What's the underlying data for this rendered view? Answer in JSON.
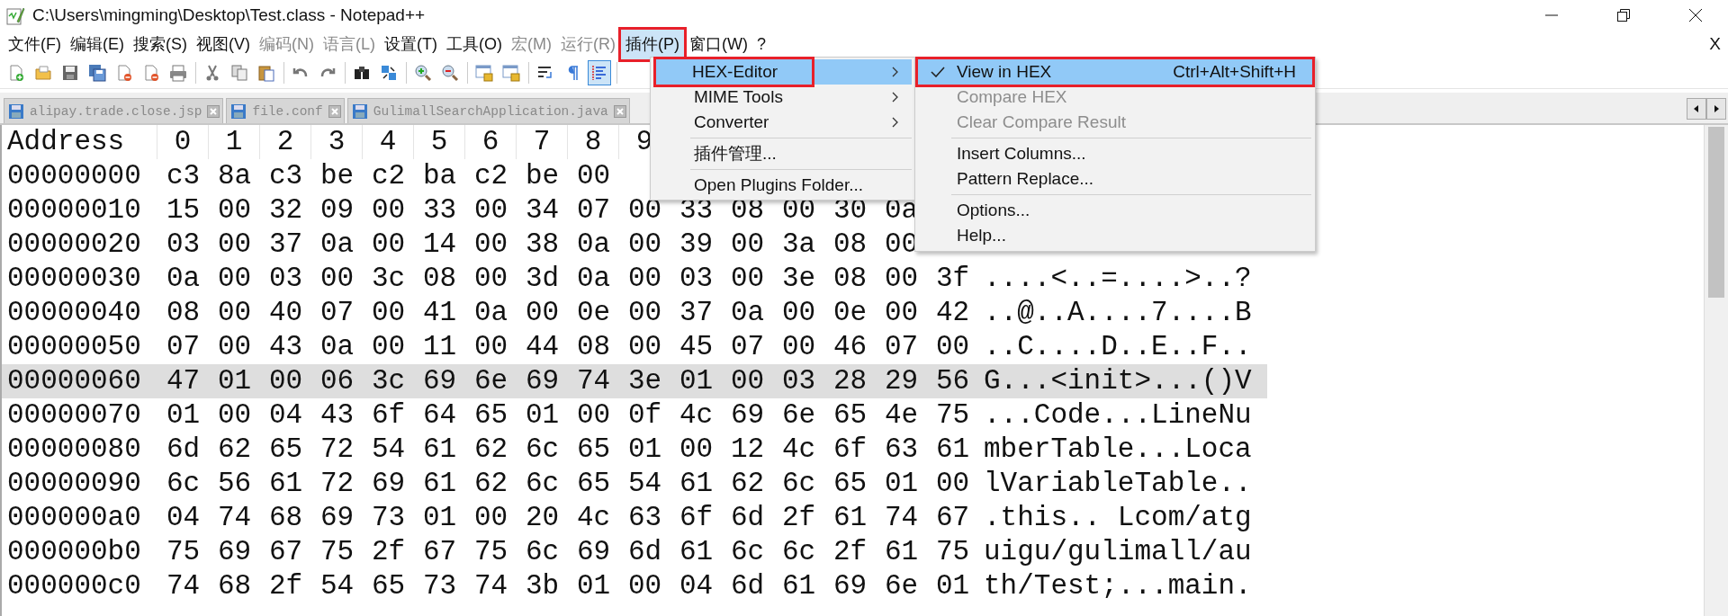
{
  "window": {
    "title": "C:\\Users\\mingming\\Desktop\\Test.class - Notepad++"
  },
  "menubar": [
    {
      "label": "文件(F)",
      "disabled": false,
      "selected": false
    },
    {
      "label": "编辑(E)",
      "disabled": false,
      "selected": false
    },
    {
      "label": "搜索(S)",
      "disabled": false,
      "selected": false
    },
    {
      "label": "视图(V)",
      "disabled": false,
      "selected": false
    },
    {
      "label": "编码(N)",
      "disabled": true,
      "selected": false
    },
    {
      "label": "语言(L)",
      "disabled": true,
      "selected": false
    },
    {
      "label": "设置(T)",
      "disabled": false,
      "selected": false
    },
    {
      "label": "工具(O)",
      "disabled": false,
      "selected": false
    },
    {
      "label": "宏(M)",
      "disabled": true,
      "selected": false
    },
    {
      "label": "运行(R)",
      "disabled": true,
      "selected": false
    },
    {
      "label": "插件(P)",
      "disabled": false,
      "selected": true
    },
    {
      "label": "窗口(W)",
      "disabled": false,
      "selected": false
    },
    {
      "label": "?",
      "disabled": false,
      "selected": false
    }
  ],
  "menubar_close": "X",
  "toolbar": [
    {
      "pressed": false
    },
    {
      "pressed": false
    },
    {
      "pressed": false
    },
    {
      "pressed": false
    },
    {
      "pressed": false
    },
    {
      "pressed": false
    },
    {
      "pressed": false
    },
    {
      "pressed": false
    },
    {
      "pressed": false
    },
    {
      "pressed": false
    },
    {
      "pressed": false
    },
    {
      "pressed": false
    },
    {
      "pressed": false
    },
    {
      "pressed": false
    },
    {
      "pressed": false
    },
    {
      "pressed": false
    },
    {
      "pressed": false
    },
    {
      "pressed": false
    },
    {
      "pressed": false
    },
    {
      "pressed": false
    },
    {
      "pressed": true
    }
  ],
  "tabs": [
    {
      "label": "alipay.trade.close.jsp",
      "selected": false
    },
    {
      "label": "file.conf",
      "selected": false
    },
    {
      "label": "GulimallSearchApplication.java",
      "selected": false
    }
  ],
  "hex": {
    "address_header": "Address",
    "column_headers": [
      "0",
      "1",
      "2",
      "3",
      "4",
      "5",
      "6",
      "7",
      "8",
      "9"
    ],
    "rows": [
      {
        "address": "00000000",
        "cells": [
          "c3",
          "8a",
          "c3",
          "be",
          "c2",
          "ba",
          "c2",
          "be",
          "00"
        ],
        "selected": false
      },
      {
        "address": "00000010",
        "cells": [
          "15",
          "00",
          "32",
          "09",
          "00",
          "33",
          "00",
          "34",
          "07",
          "00",
          "33",
          "08",
          "00",
          "30",
          "0a"
        ],
        "selected": false
      },
      {
        "address": "00000020",
        "cells": [
          "03",
          "00",
          "37",
          "0a",
          "00",
          "14",
          "00",
          "38",
          "0a",
          "00",
          "39",
          "00",
          "3a",
          "08",
          "00"
        ],
        "selected": false
      },
      {
        "address": "00000030",
        "cells": [
          "0a",
          "00",
          "03",
          "00",
          "3c",
          "08",
          "00",
          "3d",
          "0a",
          "00",
          "03",
          "00",
          "3e",
          "08",
          "00",
          "3f"
        ],
        "ascii": "....<..=....>..?",
        "selected": false
      },
      {
        "address": "00000040",
        "cells": [
          "08",
          "00",
          "40",
          "07",
          "00",
          "41",
          "0a",
          "00",
          "0e",
          "00",
          "37",
          "0a",
          "00",
          "0e",
          "00",
          "42"
        ],
        "ascii": "..@..A....7....B",
        "selected": false
      },
      {
        "address": "00000050",
        "cells": [
          "07",
          "00",
          "43",
          "0a",
          "00",
          "11",
          "00",
          "44",
          "08",
          "00",
          "45",
          "07",
          "00",
          "46",
          "07",
          "00"
        ],
        "ascii": "..C....D..E..F..",
        "selected": false
      },
      {
        "address": "00000060",
        "cells": [
          "47",
          "01",
          "00",
          "06",
          "3c",
          "69",
          "6e",
          "69",
          "74",
          "3e",
          "01",
          "00",
          "03",
          "28",
          "29",
          "56"
        ],
        "ascii": "G...<init>...()V",
        "selected": true
      },
      {
        "address": "00000070",
        "cells": [
          "01",
          "00",
          "04",
          "43",
          "6f",
          "64",
          "65",
          "01",
          "00",
          "0f",
          "4c",
          "69",
          "6e",
          "65",
          "4e",
          "75"
        ],
        "ascii": "...Code...LineNu",
        "selected": false
      },
      {
        "address": "00000080",
        "cells": [
          "6d",
          "62",
          "65",
          "72",
          "54",
          "61",
          "62",
          "6c",
          "65",
          "01",
          "00",
          "12",
          "4c",
          "6f",
          "63",
          "61"
        ],
        "ascii": "mberTable...Loca",
        "selected": false
      },
      {
        "address": "00000090",
        "cells": [
          "6c",
          "56",
          "61",
          "72",
          "69",
          "61",
          "62",
          "6c",
          "65",
          "54",
          "61",
          "62",
          "6c",
          "65",
          "01",
          "00"
        ],
        "ascii": "lVariableTable..",
        "selected": false
      },
      {
        "address": "000000a0",
        "cells": [
          "04",
          "74",
          "68",
          "69",
          "73",
          "01",
          "00",
          "20",
          "4c",
          "63",
          "6f",
          "6d",
          "2f",
          "61",
          "74",
          "67"
        ],
        "ascii": ".this.. Lcom/atg",
        "selected": false
      },
      {
        "address": "000000b0",
        "cells": [
          "75",
          "69",
          "67",
          "75",
          "2f",
          "67",
          "75",
          "6c",
          "69",
          "6d",
          "61",
          "6c",
          "6c",
          "2f",
          "61",
          "75"
        ],
        "ascii": "uigu/gulimall/au",
        "selected": false
      },
      {
        "address": "000000c0",
        "cells": [
          "74",
          "68",
          "2f",
          "54",
          "65",
          "73",
          "74",
          "3b",
          "01",
          "00",
          "04",
          "6d",
          "61",
          "69",
          "6e",
          "01"
        ],
        "ascii": "th/Test;...main.",
        "selected": false
      }
    ]
  },
  "plugins_menu": [
    {
      "kind": "submenu",
      "label": "HEX-Editor",
      "selected": true
    },
    {
      "kind": "submenu",
      "label": "MIME Tools",
      "selected": false
    },
    {
      "kind": "submenu",
      "label": "Converter",
      "selected": false
    },
    {
      "kind": "separator"
    },
    {
      "kind": "item",
      "label": "插件管理...",
      "selected": false
    },
    {
      "kind": "separator"
    },
    {
      "kind": "item",
      "label": "Open Plugins Folder...",
      "selected": false
    }
  ],
  "hex_submenu": [
    {
      "kind": "item",
      "label": "View in HEX",
      "shortcut": "Ctrl+Alt+Shift+H",
      "checked": true,
      "selected": true,
      "disabled": false
    },
    {
      "kind": "item",
      "label": "Compare HEX",
      "checked": false,
      "selected": false,
      "disabled": true
    },
    {
      "kind": "item",
      "label": "Clear Compare Result",
      "checked": false,
      "selected": false,
      "disabled": true
    },
    {
      "kind": "separator"
    },
    {
      "kind": "item",
      "label": "Insert Columns...",
      "checked": false,
      "selected": false,
      "disabled": false
    },
    {
      "kind": "item",
      "label": "Pattern Replace...",
      "checked": false,
      "selected": false,
      "disabled": false
    },
    {
      "kind": "separator"
    },
    {
      "kind": "item",
      "label": "Options...",
      "checked": false,
      "selected": false,
      "disabled": false
    },
    {
      "kind": "item",
      "label": "Help...",
      "checked": false,
      "selected": false,
      "disabled": false
    }
  ]
}
